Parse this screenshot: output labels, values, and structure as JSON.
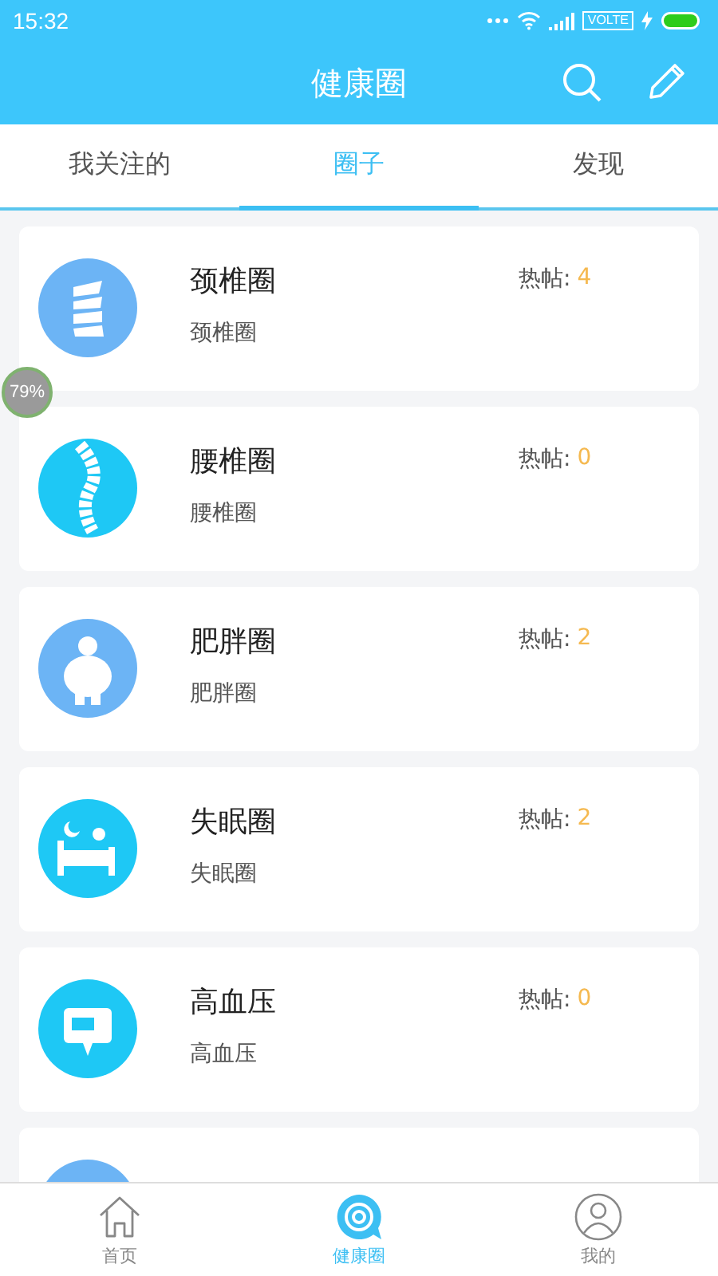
{
  "status_bar": {
    "time": "15:32",
    "network_badge": "VOLTE"
  },
  "header": {
    "title": "健康圈"
  },
  "tabs": [
    {
      "label": "我关注的",
      "selected": false
    },
    {
      "label": "圈子",
      "selected": true
    },
    {
      "label": "发现",
      "selected": false
    }
  ],
  "float_badge": "79%",
  "circles": [
    {
      "title": "颈椎圈",
      "subtitle": "颈椎圈",
      "hot_label": "热帖:",
      "hot_count": "4",
      "kind": "neck",
      "color": "#6cb4f5"
    },
    {
      "title": "腰椎圈",
      "subtitle": "腰椎圈",
      "hot_label": "热帖:",
      "hot_count": "0",
      "kind": "spine",
      "color": "#1ec8f5"
    },
    {
      "title": "肥胖圈",
      "subtitle": "肥胖圈",
      "hot_label": "热帖:",
      "hot_count": "2",
      "kind": "body",
      "color": "#6cb4f5"
    },
    {
      "title": "失眠圈",
      "subtitle": "失眠圈",
      "hot_label": "热帖:",
      "hot_count": "2",
      "kind": "bed",
      "color": "#1ec8f5"
    },
    {
      "title": "高血压",
      "subtitle": "高血压",
      "hot_label": "热帖:",
      "hot_count": "0",
      "kind": "monitor",
      "color": "#1ec8f5"
    },
    {
      "kind": "other",
      "color": "#6cb4f5"
    }
  ],
  "bottom_nav": [
    {
      "label": "首页",
      "kind": "home",
      "selected": false
    },
    {
      "label": "健康圈",
      "kind": "chat",
      "selected": true
    },
    {
      "label": "我的",
      "kind": "user",
      "selected": false
    }
  ]
}
